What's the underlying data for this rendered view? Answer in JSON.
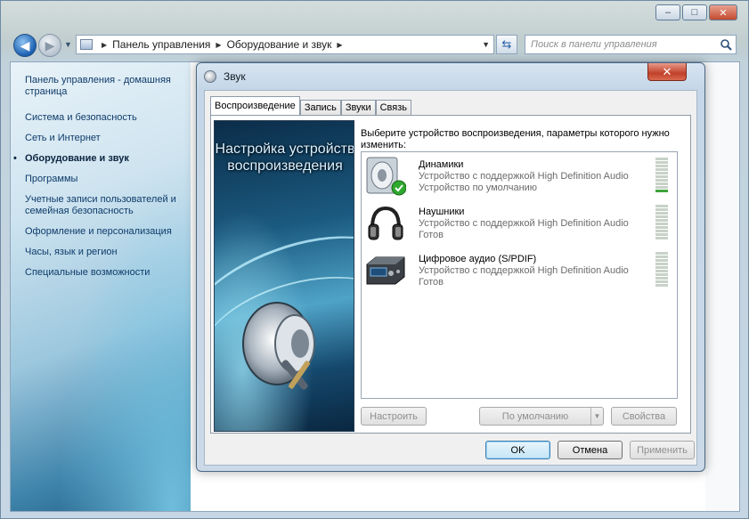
{
  "explorer": {
    "breadcrumb": [
      "Панель управления",
      "Оборудование и звук"
    ],
    "search_placeholder": "Поиск в панели управления",
    "caption": {
      "minimize": "–",
      "maximize": "□",
      "close": "✕"
    }
  },
  "sidebar": {
    "home": "Панель управления - домашняя страница",
    "items": [
      {
        "label": "Система и безопасность",
        "active": false
      },
      {
        "label": "Сеть и Интернет",
        "active": false
      },
      {
        "label": "Оборудование и звук",
        "active": true
      },
      {
        "label": "Программы",
        "active": false
      },
      {
        "label": "Учетные записи пользователей и семейная безопасность",
        "active": false
      },
      {
        "label": "Оформление и персонализация",
        "active": false
      },
      {
        "label": "Часы, язык и регион",
        "active": false
      },
      {
        "label": "Специальные возможности",
        "active": false
      }
    ]
  },
  "dialog": {
    "title": "Звук",
    "tabs": [
      "Воспроизведение",
      "Запись",
      "Звуки",
      "Связь"
    ],
    "active_tab": 0,
    "hero_title": "Настройка устройств воспроизведения",
    "description": "Выберите устройство воспроизведения, параметры которого нужно изменить:",
    "devices": [
      {
        "name": "Динамики",
        "line1": "Устройство с поддержкой High Definition Audio",
        "line2": "Устройство по умолчанию",
        "icon": "speaker-icon",
        "default": true,
        "level": 0.1
      },
      {
        "name": "Наушники",
        "line1": "Устройство с поддержкой High Definition Audio",
        "line2": "Готов",
        "icon": "headphones-icon",
        "default": false,
        "level": 0
      },
      {
        "name": "Цифровое аудио (S/PDIF)",
        "line1": "Устройство с поддержкой High Definition Audio",
        "line2": "Готов",
        "icon": "digital-audio-icon",
        "default": false,
        "level": 0
      }
    ],
    "buttons": {
      "configure": "Настроить",
      "set_default": "По умолчанию",
      "properties": "Свойства",
      "ok": "OK",
      "cancel": "Отмена",
      "apply": "Применить"
    },
    "colors": {
      "level_on": "#3ea43e",
      "level_off": "#c8d2c8"
    }
  }
}
